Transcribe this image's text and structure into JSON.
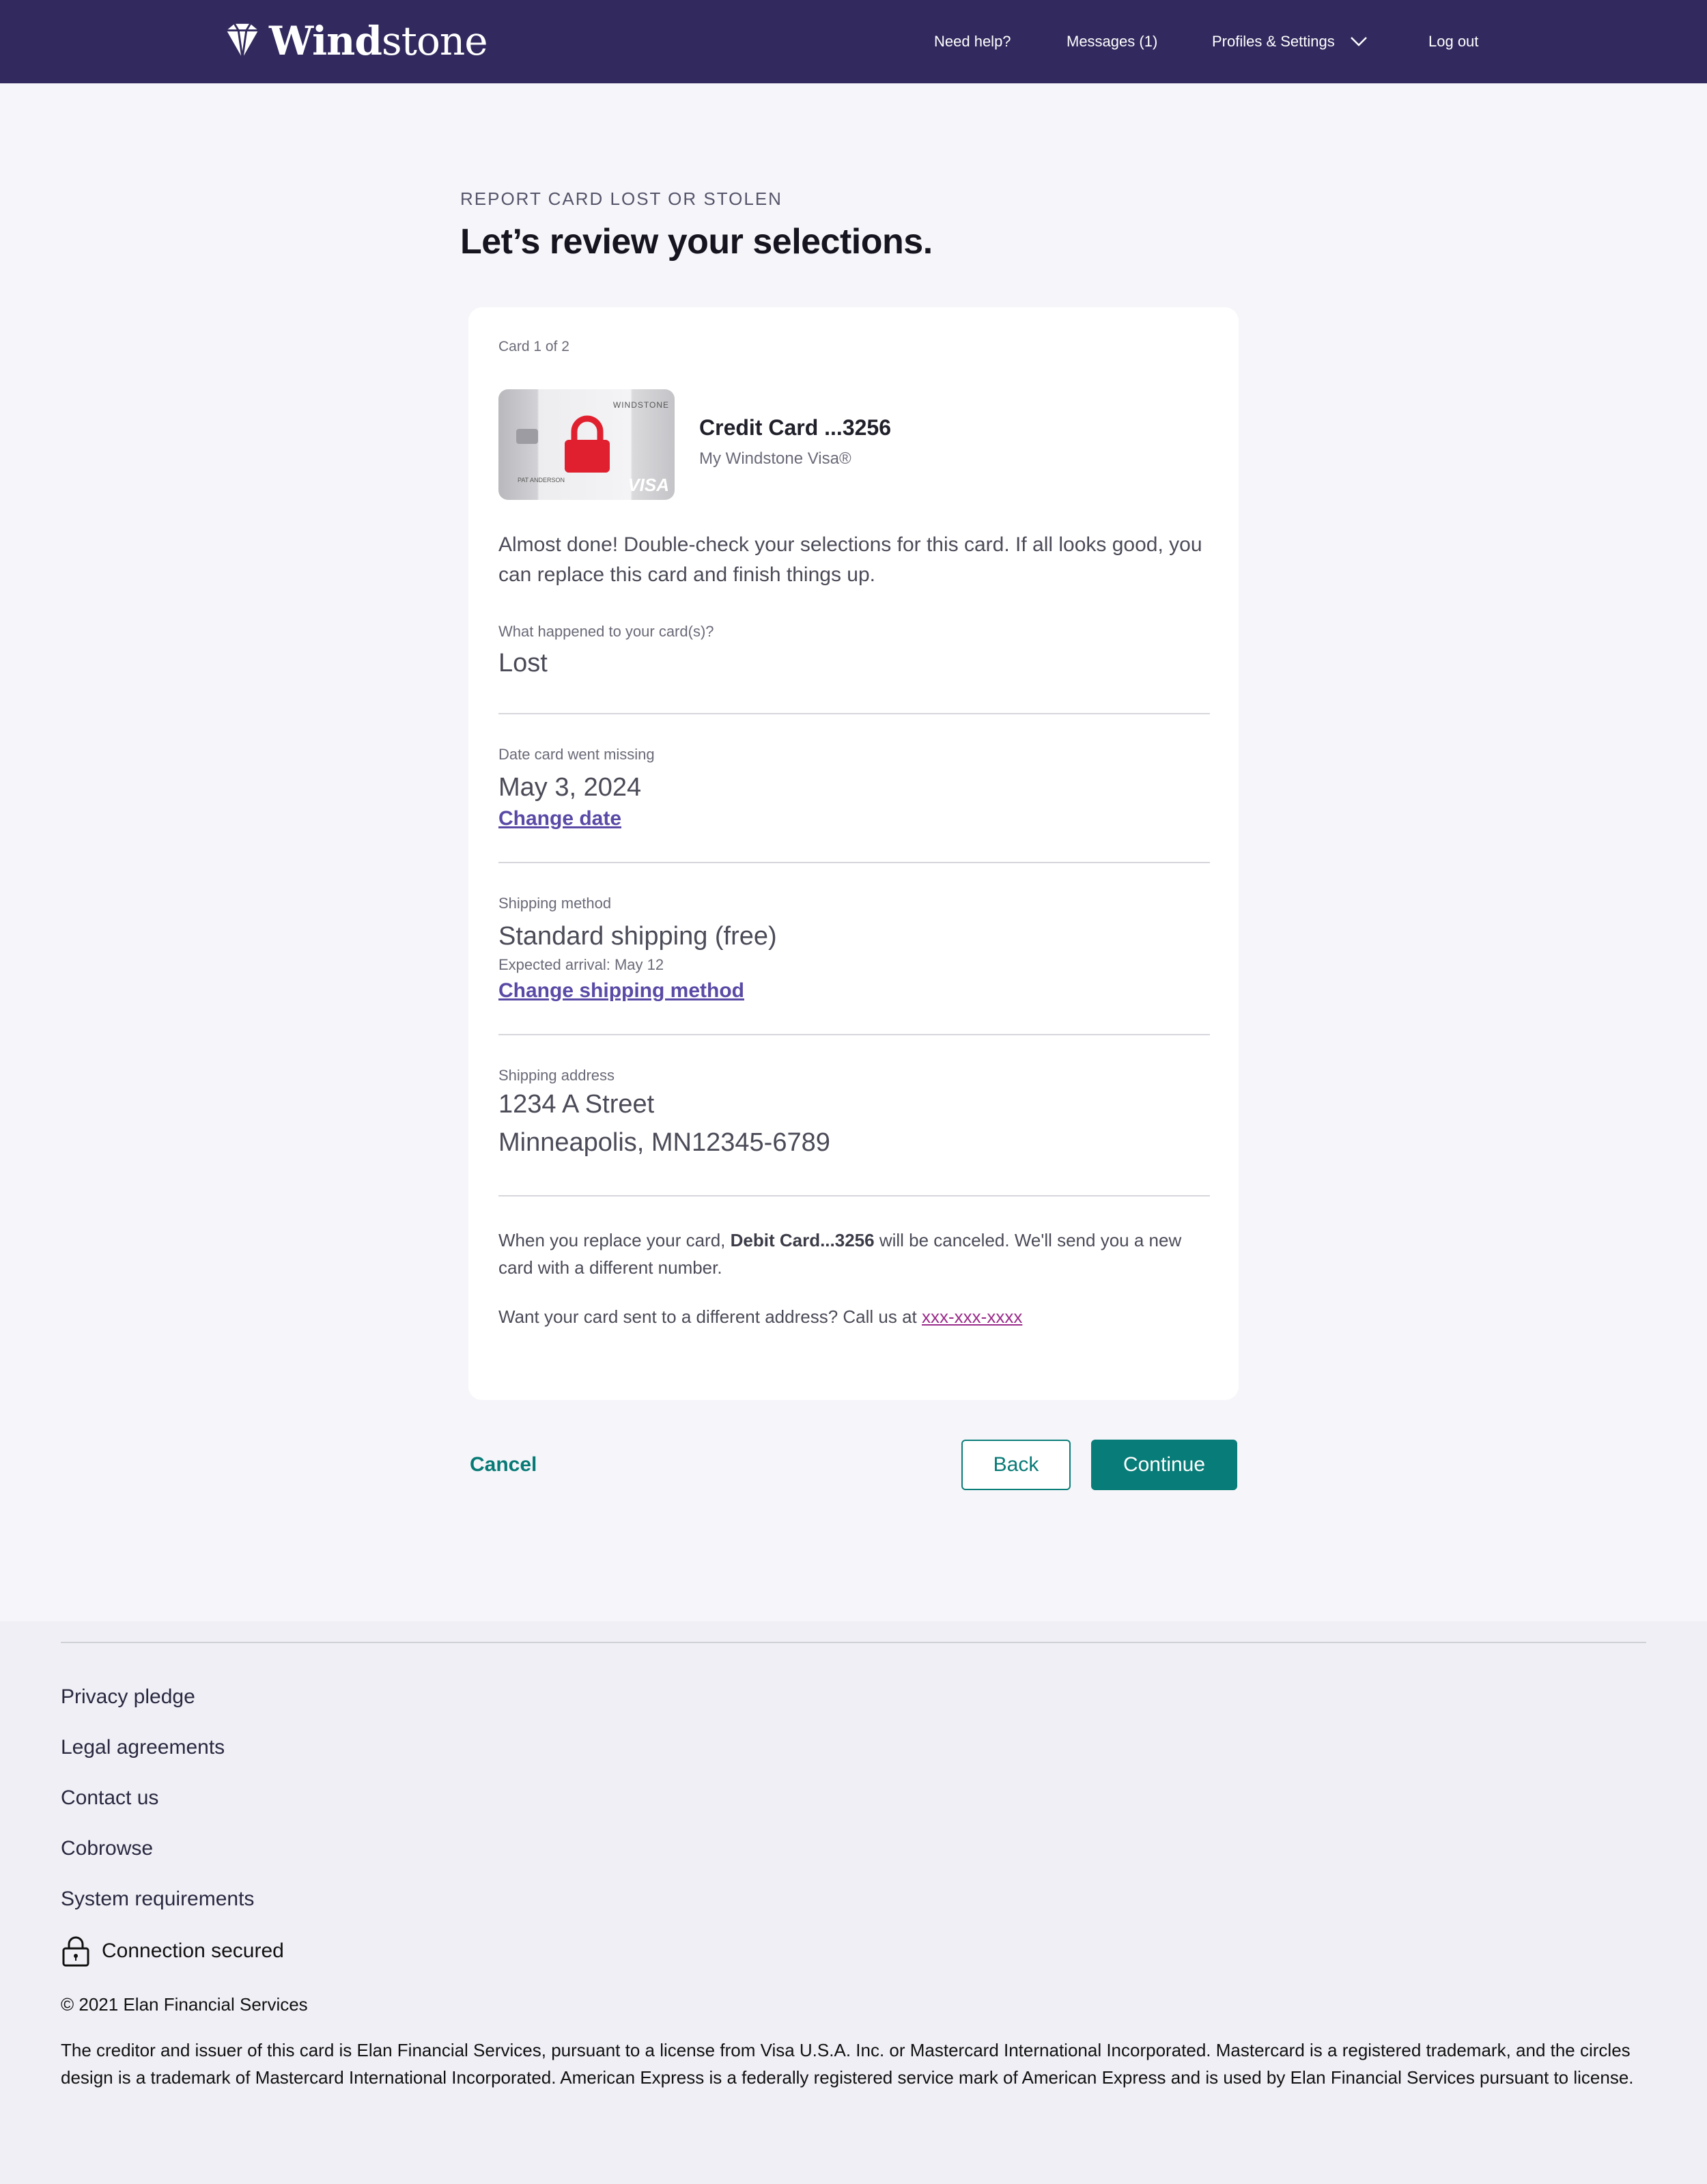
{
  "header": {
    "brand_bold": "Wind",
    "brand_light": "stone",
    "nav": {
      "help": "Need help?",
      "messages": "Messages (1)",
      "profiles": "Profiles & Settings",
      "logout": "Log out"
    }
  },
  "main": {
    "eyebrow": "REPORT CARD LOST OR STOLEN",
    "title": "Let’s review your selections.",
    "card_counter": "Card 1 of 2",
    "card": {
      "name": "Credit Card ...3256",
      "product": "My Windstone Visa®",
      "art_brand": "WINDSTONE",
      "art_network": "VISA",
      "art_holder": "PAT ANDERSON"
    },
    "intro": "Almost done! Double-check your selections for this card. If all looks good, you can replace this card and finish things up.",
    "what_happened": {
      "label": "What happened to your card(s)?",
      "value": "Lost"
    },
    "date_missing": {
      "label": "Date card went missing",
      "value": "May 3, 2024",
      "link": "Change date"
    },
    "shipping": {
      "label": "Shipping method",
      "value": "Standard shipping (free)",
      "note": "Expected arrival: May 12",
      "link": "Change shipping method"
    },
    "address": {
      "label": "Shipping address",
      "line1": "1234 A Street",
      "line2": "Minneapolis, MN12345-6789"
    },
    "replace_note": {
      "before": "When you replace your card, ",
      "bold": "Debit Card...3256",
      "after": " will be canceled. We'll send you a new card with a different number."
    },
    "address_note": {
      "text": "Want your card sent to a different address? Call us at ",
      "phone": "xxx-xxx-xxxx"
    },
    "actions": {
      "cancel": "Cancel",
      "back": "Back",
      "continue": "Continue"
    }
  },
  "footer": {
    "links": [
      "Privacy pledge",
      "Legal agreements",
      "Contact us",
      "Cobrowse",
      "System requirements"
    ],
    "secured": "Connection secured",
    "copyright": "© 2021 Elan Financial Services",
    "legal": "The creditor and issuer of this card is Elan Financial Services, pursuant to a license from Visa U.S.A. Inc. or Mastercard International Incorporated. Mastercard is a registered trademark, and the circles design is a trademark of Mastercard International Incorporated. American Express is a federally registered service mark of American Express and is used by Elan Financial Services pursuant to license."
  },
  "colors": {
    "header_bg": "#322a5e",
    "accent_teal": "#087c78",
    "link_purple": "#5a4aa6",
    "lock_red": "#e0202e"
  }
}
